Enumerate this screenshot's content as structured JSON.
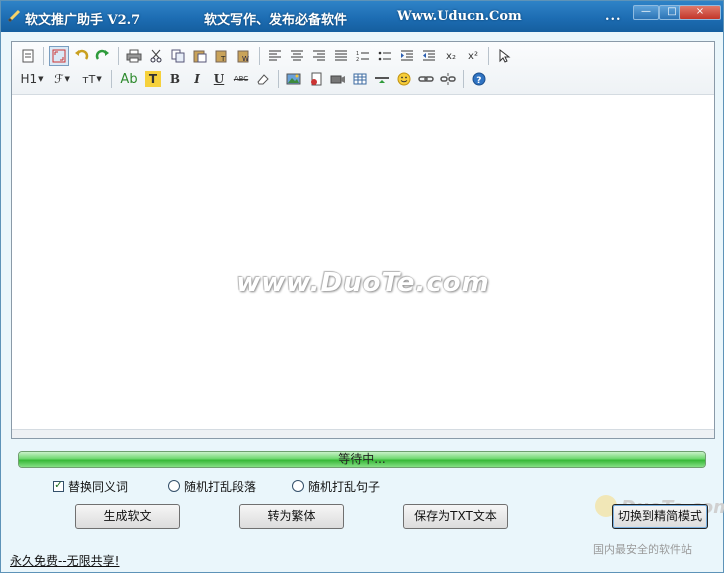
{
  "window": {
    "title": "软文推广助手 V2.7",
    "tagline": "软文写作、发布必备软件",
    "website": "Www.Uducn.Com",
    "menu_dots": "...",
    "minimize_glyph": "—",
    "maximize_glyph": "□",
    "close_glyph": "×"
  },
  "toolbar": {
    "row1": [
      "new-doc-icon",
      "fullscreen-icon",
      "undo-icon",
      "redo-icon",
      "print-icon",
      "cut-icon",
      "copy-icon",
      "paste-icon",
      "paste-text-icon",
      "paste-word-icon",
      "align-left-icon",
      "align-center-icon",
      "align-right-icon",
      "justify-icon",
      "ordered-list-icon",
      "unordered-list-icon",
      "indent-icon",
      "outdent-icon",
      "subscript-icon",
      "superscript-icon",
      "select-pointer-icon"
    ],
    "row2_labels": {
      "heading": "H1",
      "font": "ℱ",
      "font_size": "тT",
      "font_color": "Ab",
      "highlight": "T",
      "bold": "B",
      "italic": "I",
      "underline": "U",
      "strike": "ABC",
      "subscript": "x₂",
      "superscript": "x²"
    }
  },
  "editor": {
    "content": "",
    "watermark": "www.DuoTe.com"
  },
  "progress": {
    "label": "等待中...",
    "fraction": 1.0,
    "color": "#37b837"
  },
  "options": {
    "replace_synonyms": {
      "label": "替换同义词",
      "checked": true
    },
    "shuffle_paragraphs": {
      "label": "随机打乱段落",
      "checked": false
    },
    "shuffle_sentences": {
      "label": "随机打乱句子",
      "checked": false
    }
  },
  "buttons": {
    "generate": "生成软文",
    "traditional": "转为繁体",
    "save_txt": "保存为TXT文本",
    "simple_mode": "切换到精简模式"
  },
  "footer": {
    "link": "永久免费--无限共享!",
    "site_watermark": "国内最安全的软件站",
    "site_logo": "DuoTe.com"
  }
}
